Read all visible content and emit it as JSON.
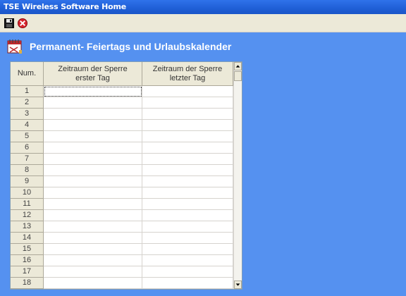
{
  "window": {
    "title": "TSE Wireless Software Home"
  },
  "toolbar": {
    "save_icon": "save-icon",
    "close_icon": "close-icon"
  },
  "page": {
    "title": "Permanent- Feiertags und Urlaubskalender",
    "icon": "calendar-icon"
  },
  "table": {
    "columns": [
      {
        "label": "Num."
      },
      {
        "label_line1": "Zeitraum der Sperre",
        "label_line2": "erster Tag"
      },
      {
        "label_line1": "Zeitraum der Sperre",
        "label_line2": "letzter Tag"
      }
    ],
    "rows": [
      {
        "num": "1",
        "first": "",
        "last": ""
      },
      {
        "num": "2",
        "first": "",
        "last": ""
      },
      {
        "num": "3",
        "first": "",
        "last": ""
      },
      {
        "num": "4",
        "first": "",
        "last": ""
      },
      {
        "num": "5",
        "first": "",
        "last": ""
      },
      {
        "num": "6",
        "first": "",
        "last": ""
      },
      {
        "num": "7",
        "first": "",
        "last": ""
      },
      {
        "num": "8",
        "first": "",
        "last": ""
      },
      {
        "num": "9",
        "first": "",
        "last": ""
      },
      {
        "num": "10",
        "first": "",
        "last": ""
      },
      {
        "num": "11",
        "first": "",
        "last": ""
      },
      {
        "num": "12",
        "first": "",
        "last": ""
      },
      {
        "num": "13",
        "first": "",
        "last": ""
      },
      {
        "num": "14",
        "first": "",
        "last": ""
      },
      {
        "num": "15",
        "first": "",
        "last": ""
      },
      {
        "num": "16",
        "first": "",
        "last": ""
      },
      {
        "num": "17",
        "first": "",
        "last": ""
      },
      {
        "num": "18",
        "first": "",
        "last": ""
      }
    ]
  },
  "colors": {
    "desktop": "#5591f0",
    "titlebar": "#1f5fd6",
    "toolbar": "#ece9d8"
  }
}
